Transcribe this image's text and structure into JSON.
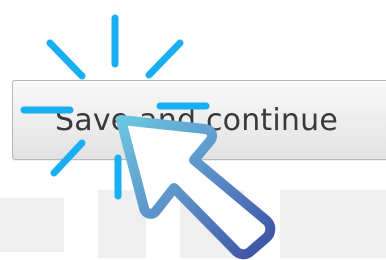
{
  "button": {
    "label": "Save and continue"
  },
  "icons": {
    "click_burst": "click-burst-icon",
    "pointer": "mouse-pointer-icon"
  },
  "colors": {
    "burst": "#18aef2",
    "pointer_gradient_start": "#65c0df",
    "pointer_gradient_end": "#3d55a9",
    "button_text": "#3a3a3a"
  }
}
